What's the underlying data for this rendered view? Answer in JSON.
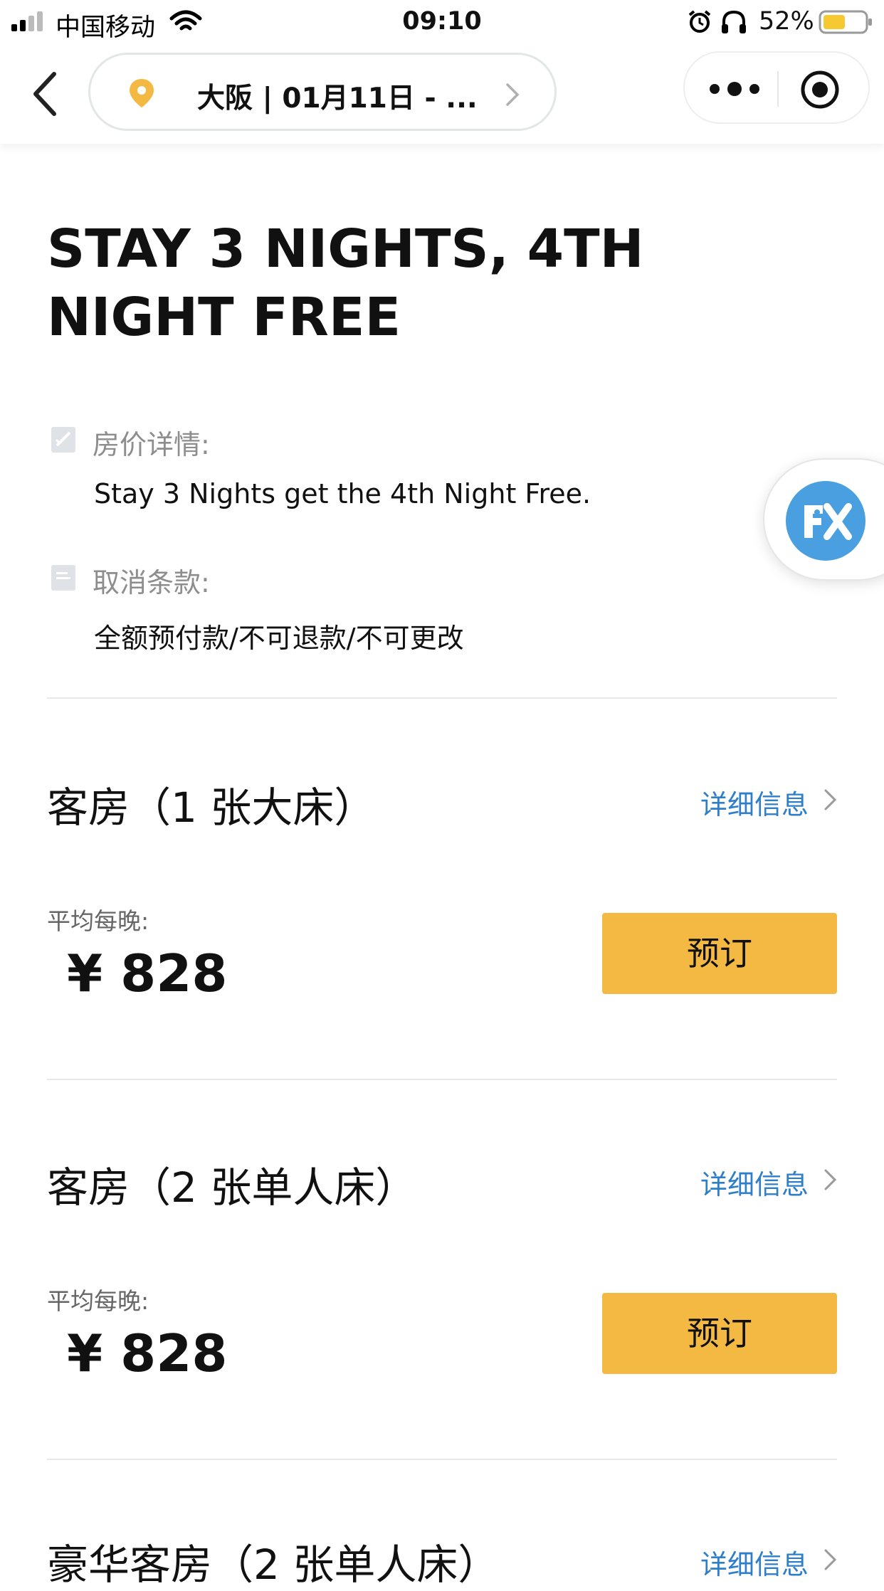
{
  "status_bar": {
    "carrier": "中国移动",
    "time": "09:10",
    "battery": "52%"
  },
  "nav": {
    "location_text": "大阪 |  01月11日 - ...",
    "colors": {
      "pin": "#f3b942",
      "border": "#e3e6e6"
    }
  },
  "offer": {
    "title": "STAY 3 NIGHTS, 4TH NIGHT FREE",
    "price_details_label": "房价详情:",
    "price_details_text": "Stay 3 Nights get the 4th Night Free.",
    "cancel_label": "取消条款:",
    "cancel_text": "全额预付款/不可退款/不可更改"
  },
  "rooms": [
    {
      "name": "客房（1 张大床）",
      "detail_link": "详细信息",
      "avg_label": "平均每晚:",
      "price": "¥ 828",
      "book_label": "预订"
    },
    {
      "name": "客房（2 张单人床）",
      "detail_link": "详细信息",
      "avg_label": "平均每晚:",
      "price": "¥ 828",
      "book_label": "预订"
    },
    {
      "name": "豪华客房（2 张单人床）",
      "detail_link": "详细信息"
    }
  ],
  "colors": {
    "accent": "#f3b942",
    "link": "#2f7ec9",
    "float_icon": "#4a9fe0"
  },
  "icons": {
    "back": "chevron-left-icon",
    "pin": "map-pin-icon",
    "more": "more-dots-icon",
    "close_target": "target-icon",
    "float": "fx-icon"
  }
}
